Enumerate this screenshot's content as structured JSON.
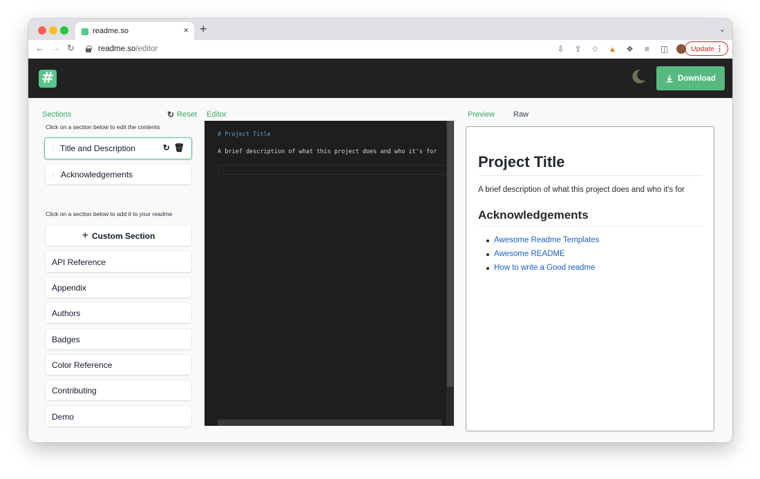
{
  "browser": {
    "tab_title": "readme.so",
    "tab_close": "×",
    "new_tab": "+",
    "url_host": "readme.so",
    "url_path": "/editor",
    "update_label": "Update",
    "update_menu": "⋮"
  },
  "app": {
    "logo_glyph": "#",
    "download_label": "Download",
    "accent_color": "#57c68b"
  },
  "sections": {
    "title": "Sections",
    "reset_label": "Reset",
    "edit_hint": "Click on a section below to edit the contents",
    "active": [
      {
        "label": "Title and Description"
      },
      {
        "label": "Acknowledgements"
      }
    ],
    "add_hint": "Click on a section below to add it to your readme",
    "custom_label": "Custom Section",
    "available": [
      {
        "label": "API Reference"
      },
      {
        "label": "Appendix"
      },
      {
        "label": "Authors"
      },
      {
        "label": "Badges"
      },
      {
        "label": "Color Reference"
      },
      {
        "label": "Contributing"
      },
      {
        "label": "Demo"
      }
    ]
  },
  "editor": {
    "title": "Editor",
    "lines": [
      "# Project Title",
      "A brief description of what this project does and who it's for"
    ]
  },
  "preview": {
    "tab_preview": "Preview",
    "tab_raw": "Raw",
    "h1": "Project Title",
    "paragraph": "A brief description of what this project does and who it's for",
    "h2": "Acknowledgements",
    "links": [
      "Awesome Readme Templates",
      "Awesome README",
      "How to write a Good readme"
    ]
  }
}
